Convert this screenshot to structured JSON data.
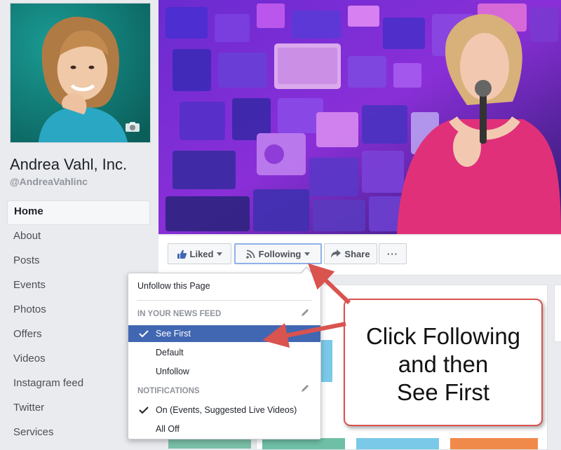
{
  "page": {
    "name": "Andrea Vahl, Inc.",
    "handle": "@AndreaVahlinc"
  },
  "nav": {
    "items": [
      {
        "label": "Home",
        "active": true
      },
      {
        "label": "About"
      },
      {
        "label": "Posts"
      },
      {
        "label": "Events"
      },
      {
        "label": "Photos"
      },
      {
        "label": "Offers"
      },
      {
        "label": "Videos"
      },
      {
        "label": "Instagram feed"
      },
      {
        "label": "Twitter"
      },
      {
        "label": "Services"
      }
    ]
  },
  "actions": {
    "liked": "Liked",
    "following": "Following",
    "share": "Share",
    "more": "···"
  },
  "dropdown": {
    "unfollow_page": "Unfollow this Page",
    "news_feed_header": "IN YOUR NEWS FEED",
    "see_first": "See First",
    "default": "Default",
    "unfollow": "Unfollow",
    "notifications_header": "NOTIFICATIONS",
    "on_events": "On (Events, Suggested Live Videos)",
    "all_off": "All Off"
  },
  "annotation": {
    "line1": "Click Following",
    "line2": "and then",
    "line3": "See First"
  },
  "colors": {
    "accent": "#4267b2",
    "annotation": "#d9534f",
    "highlight": "#8fb1e8"
  }
}
